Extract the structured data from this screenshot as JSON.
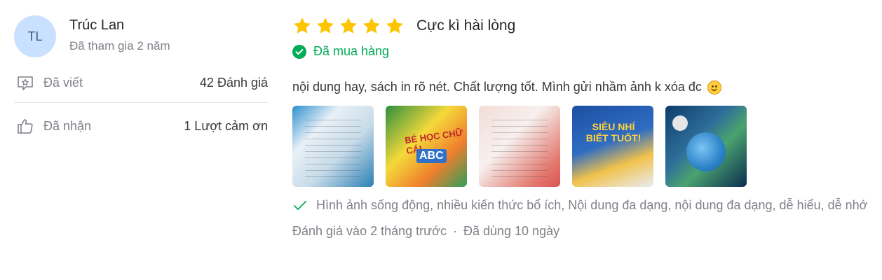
{
  "reviewer": {
    "initials": "TL",
    "name": "Trúc Lan",
    "joined": "Đã tham gia 2 năm",
    "stats": [
      {
        "icon": "review-written-icon",
        "label": "Đã viết",
        "value": "42 Đánh giá"
      },
      {
        "icon": "thumbs-up-icon",
        "label": "Đã nhận",
        "value": "1 Lượt cảm ơn"
      }
    ]
  },
  "review": {
    "rating": 5,
    "rating_title": "Cực kì hài lòng",
    "purchased_label": "Đã mua hàng",
    "content": "nội dung hay, sách in rõ nét. Chất lượng tốt. Mình gửi nhầm ảnh k xóa đc",
    "photos": [
      {
        "caption": ""
      },
      {
        "caption": "BÉ HỌC CHỮ CÁI",
        "sub": "ABC"
      },
      {
        "caption": ""
      },
      {
        "caption": "SIÊU NHÍ BIẾT TUỐT!"
      },
      {
        "caption": ""
      }
    ],
    "attributes": "Hình ảnh sống động, nhiều kiến thức bổ ích, Nội dung đa dạng, nội dung đa dạng, dễ hiểu, dễ nhớ",
    "reviewed_at": "Đánh giá vào 2 tháng trước",
    "used_for": "Đã dùng 10 ngày"
  },
  "colors": {
    "star": "#FFC400",
    "purchased": "#00AB56",
    "avatar_bg": "#C9E1FF",
    "muted_text": "#808089"
  }
}
